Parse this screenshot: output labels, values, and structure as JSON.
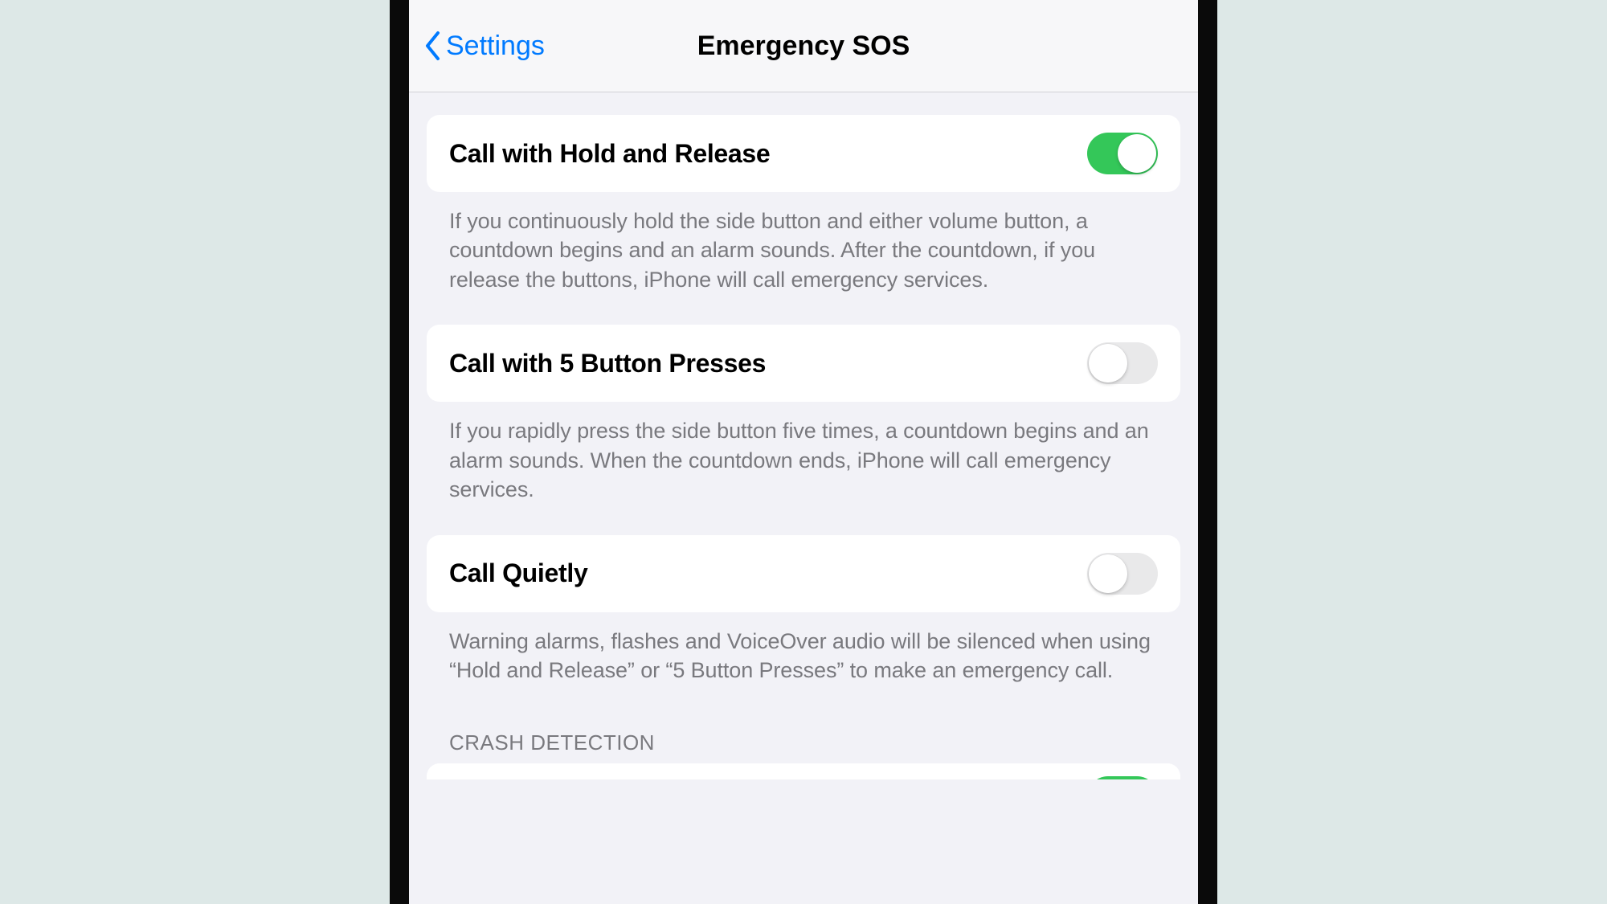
{
  "nav": {
    "back_label": "Settings",
    "title": "Emergency SOS"
  },
  "settings": {
    "hold_release": {
      "label": "Call with Hold and Release",
      "description": "If you continuously hold the side button and either volume button, a countdown begins and an alarm sounds. After the countdown, if you release the buttons, iPhone will call emergency services.",
      "enabled": true
    },
    "five_presses": {
      "label": "Call with 5 Button Presses",
      "description": "If you rapidly press the side button five times, a countdown begins and an alarm sounds. When the countdown ends, iPhone will call emergency services.",
      "enabled": false
    },
    "call_quietly": {
      "label": "Call Quietly",
      "description": "Warning alarms, flashes and VoiceOver audio will be silenced when using “Hold and Release” or “5 Button Presses” to make an emergency call.",
      "enabled": false
    }
  },
  "sections": {
    "crash_detection": "CRASH DETECTION"
  },
  "colors": {
    "accent": "#007aff",
    "toggle_on": "#34c759",
    "toggle_off": "#e9e9ea",
    "background": "#f2f2f7"
  }
}
